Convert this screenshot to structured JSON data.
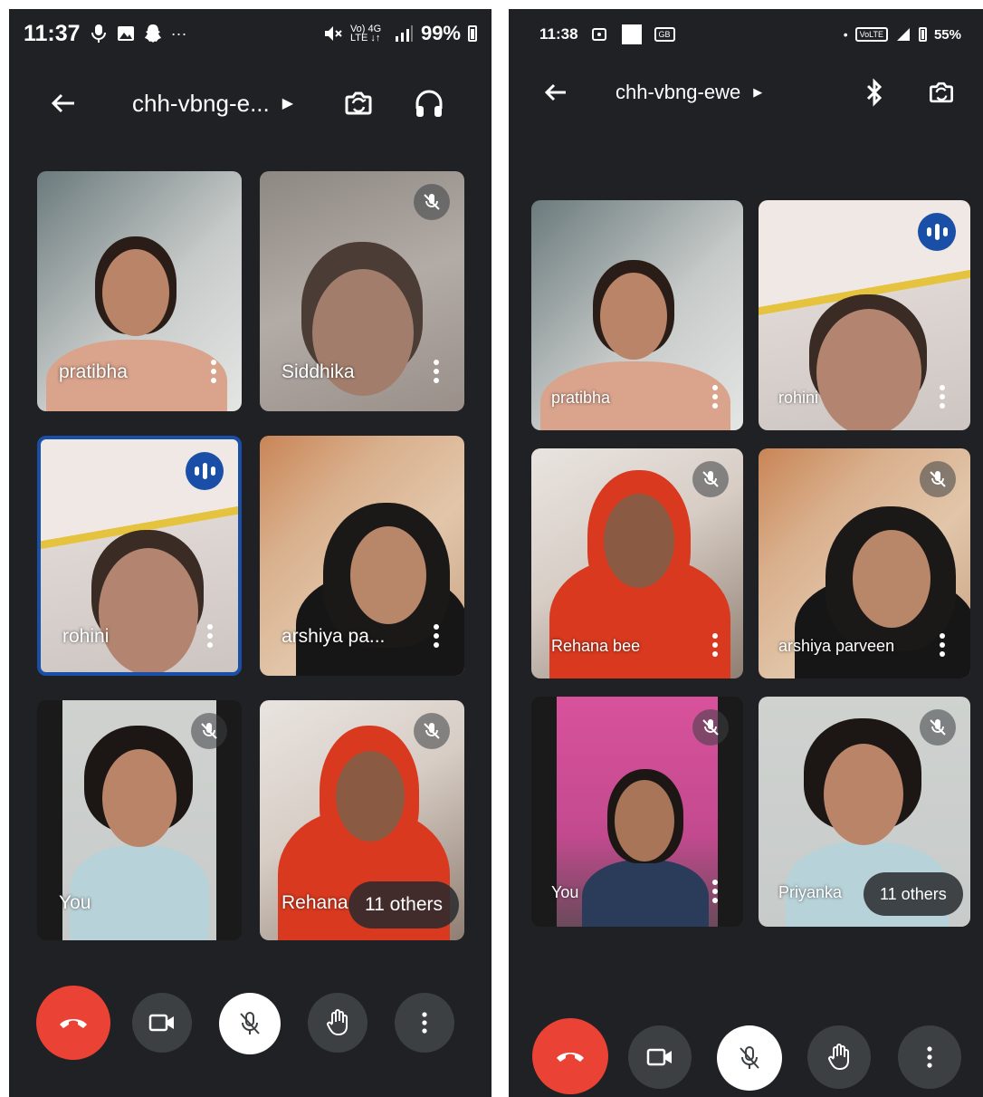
{
  "left_screen": {
    "status_bar": {
      "time": "11:37",
      "battery": "99%",
      "network": "Vo) LTE 4G"
    },
    "meeting_code": "chh-vbng-e...",
    "tiles": [
      {
        "name": "pratibha",
        "muted": false,
        "speaking": false
      },
      {
        "name": "Siddhika",
        "muted": true,
        "speaking": false
      },
      {
        "name": "rohini",
        "muted": false,
        "speaking": true
      },
      {
        "name": "arshiya pa...",
        "muted": false,
        "speaking": false
      },
      {
        "name": "You",
        "muted": true,
        "speaking": false
      },
      {
        "name": "Rehana",
        "muted": true,
        "speaking": false
      }
    ],
    "others_label": "11 others"
  },
  "right_screen": {
    "status_bar": {
      "time": "11:38",
      "battery": "55%"
    },
    "meeting_code": "chh-vbng-ewe",
    "tiles": [
      {
        "name": "pratibha",
        "muted": false,
        "speaking": false
      },
      {
        "name": "rohini",
        "muted": false,
        "speaking": true
      },
      {
        "name": "Rehana bee",
        "muted": true,
        "speaking": false
      },
      {
        "name": "arshiya parveen",
        "muted": true,
        "speaking": false
      },
      {
        "name": "You",
        "muted": true,
        "speaking": false
      },
      {
        "name": "Priyanka",
        "muted": true,
        "speaking": false
      }
    ],
    "others_label": "11 others"
  },
  "icons": {
    "back": "arrow-left-icon",
    "switch_camera": "camera-switch-icon",
    "audio_output": "headphones-icon",
    "bluetooth": "bluetooth-icon",
    "end_call": "phone-hangup-icon",
    "camera": "video-camera-icon",
    "mic": "mic-off-icon",
    "raise_hand": "hand-icon",
    "more": "more-vert-icon"
  },
  "colors": {
    "background": "#202124",
    "end_call": "#ea4335",
    "control_button": "#3c4043",
    "speaking_indicator": "#1a4fa8"
  }
}
